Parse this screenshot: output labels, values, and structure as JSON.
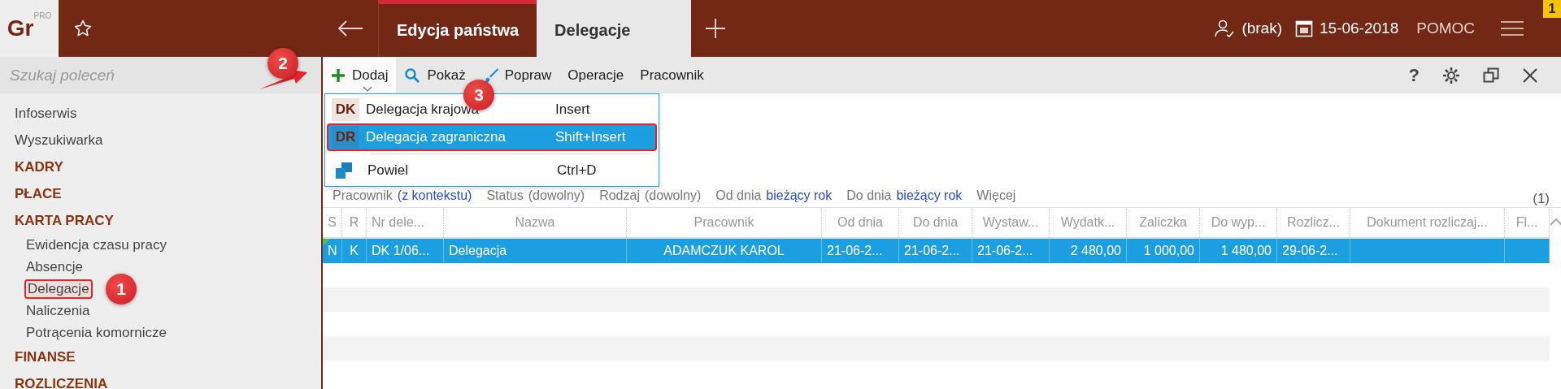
{
  "logo": {
    "text": "Gr",
    "sup": "PRO"
  },
  "tabs": [
    {
      "label": "Edycja państwa",
      "selected": false
    },
    {
      "label": "Delegacje",
      "selected": true
    }
  ],
  "topbar": {
    "user": "(brak)",
    "date": "15-06-2018",
    "help": "POMOC",
    "badge": "1"
  },
  "sidebar": {
    "search": {
      "placeholder": "Szukaj poleceń"
    },
    "items": [
      {
        "label": "Infoserwis",
        "kind": "link",
        "selected": false,
        "outlined": false
      },
      {
        "label": "Wyszukiwarka",
        "kind": "link",
        "selected": false,
        "outlined": false
      },
      {
        "label": "KADRY",
        "kind": "section",
        "selected": false,
        "outlined": false
      },
      {
        "label": "PŁACE",
        "kind": "section",
        "selected": false,
        "outlined": false
      },
      {
        "label": "KARTA PRACY",
        "kind": "section",
        "selected": false,
        "outlined": false
      },
      {
        "label": "Ewidencja czasu pracy",
        "kind": "sub",
        "selected": false,
        "outlined": false
      },
      {
        "label": "Absencje",
        "kind": "sub",
        "selected": false,
        "outlined": false
      },
      {
        "label": "Delegacje",
        "kind": "sub",
        "selected": true,
        "outlined": true,
        "callout": "1"
      },
      {
        "label": "Naliczenia",
        "kind": "sub",
        "selected": false,
        "outlined": false
      },
      {
        "label": "Potrącenia komornicze",
        "kind": "sub",
        "selected": false,
        "outlined": false
      },
      {
        "label": "FINANSE",
        "kind": "section",
        "selected": false,
        "outlined": false
      },
      {
        "label": "ROZLICZENIA",
        "kind": "section",
        "selected": false,
        "outlined": false
      }
    ]
  },
  "toolbar": {
    "buttons": [
      {
        "label": "Dodaj",
        "kind": "add",
        "expanded": true,
        "callout": "2"
      },
      {
        "label": "Pokaż",
        "kind": "search"
      },
      {
        "label": "Popraw",
        "kind": "brush"
      },
      {
        "label": "Operacje",
        "kind": "plain"
      },
      {
        "label": "Pracownik",
        "kind": "plain"
      }
    ],
    "help": "?"
  },
  "menu": {
    "items": [
      {
        "code": "DK",
        "label": "Delegacja krajowa",
        "shortcut": "Insert",
        "kind": "code",
        "selected": false,
        "outlined": false,
        "callout": "3"
      },
      {
        "code": "DR",
        "label": "Delegacja zagraniczna",
        "shortcut": "Shift+Insert",
        "kind": "code",
        "selected": true,
        "outlined": true
      },
      {
        "label": "Powiel",
        "shortcut": "Ctrl+D",
        "kind": "duplicate",
        "selected": false,
        "outlined": false
      }
    ]
  },
  "filters": [
    {
      "label": "Pracownik",
      "value": "(z kontekstu)",
      "link": true
    },
    {
      "label": "Status",
      "value": "(dowolny)",
      "link": false
    },
    {
      "label": "Rodzaj",
      "value": "(dowolny)",
      "link": false
    },
    {
      "label": "Od dnia",
      "value": "bieżący rok",
      "link": true
    },
    {
      "label": "Do dnia",
      "value": "bieżący rok",
      "link": true
    },
    {
      "label": "Więcej"
    }
  ],
  "count": "(1)",
  "table": {
    "columns": [
      {
        "label": "S"
      },
      {
        "label": "R"
      },
      {
        "label": "Nr dele..."
      },
      {
        "label": "Nazwa"
      },
      {
        "label": "Pracownik"
      },
      {
        "label": "Od dnia"
      },
      {
        "label": "Do dnia"
      },
      {
        "label": "Wystaw..."
      },
      {
        "label": "Wydatk..."
      },
      {
        "label": "Zaliczka"
      },
      {
        "label": "Do wyp..."
      },
      {
        "label": "Rozlicz..."
      },
      {
        "label": "Dokument rozliczaj..."
      },
      {
        "label": "Fl..."
      }
    ],
    "rows": [
      {
        "selected": true,
        "flagged": true,
        "cells": [
          "N",
          "K",
          "DK 1/06...",
          "Delegacja",
          "ADAMCZUK KAROL",
          "21-06-2...",
          "21-06-2...",
          "21-06-2...",
          "2 480,00",
          "1 000,00",
          "1 480,00",
          "29-06-2..."
        ]
      }
    ]
  }
}
